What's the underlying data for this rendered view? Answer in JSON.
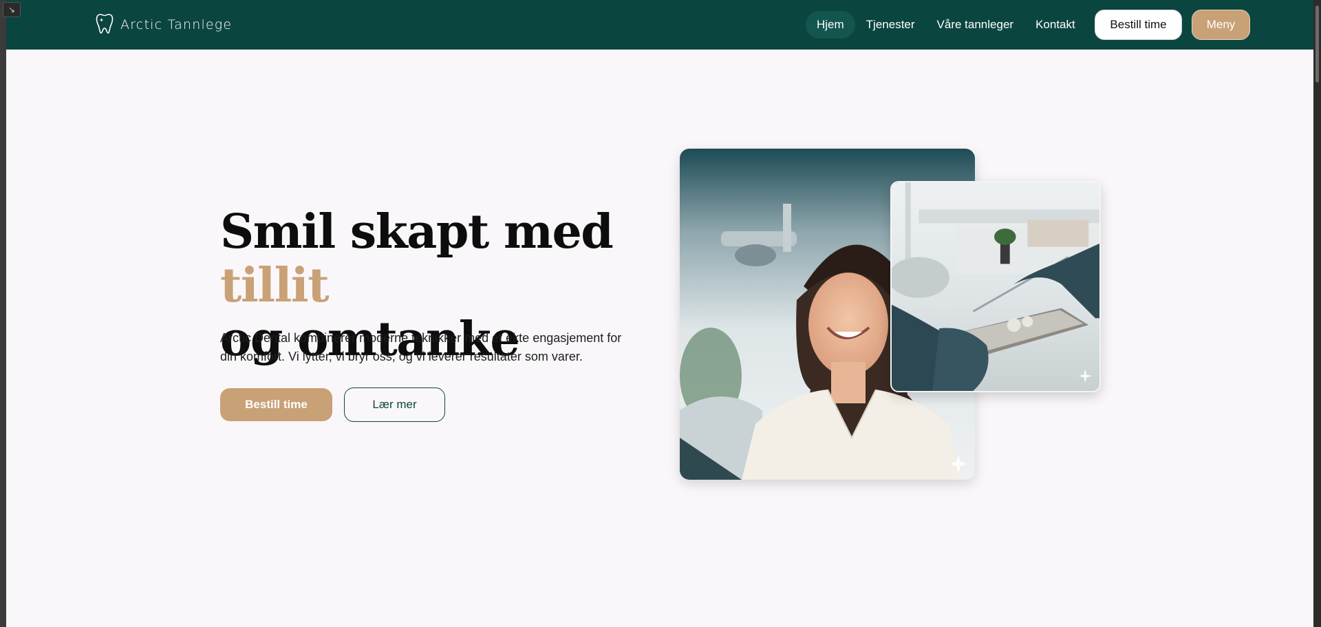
{
  "brand": {
    "name": "Arctic Tannlege",
    "logo_icon": "tooth-icon"
  },
  "nav": {
    "items": [
      {
        "label": "Hjem",
        "active": true
      },
      {
        "label": "Tjenester",
        "active": false
      },
      {
        "label": "Våre tannleger",
        "active": false
      },
      {
        "label": "Kontakt",
        "active": false
      }
    ],
    "book_label": "Bestill time",
    "menu_label": "Meny"
  },
  "hero": {
    "title_part1": "Smil skapt med ",
    "title_accent": "tillit",
    "title_part2": "og omtanke",
    "description": "Arctic Dental kombinerer moderne teknikker med et ekte engasjement for din komfort. Vi lytter, vi bryr oss, og vi leverer resultater som varer.",
    "primary_button": "Bestill time",
    "secondary_button": "Lær mer"
  },
  "images": {
    "main": "smiling-patient-photo",
    "secondary": "dental-instruments-photo"
  },
  "colors": {
    "nav_bg": "#0b4540",
    "accent": "#c9a177",
    "page_bg": "#f9f7f9"
  },
  "window": {
    "corner_icon": "resize-arrow-icon",
    "corner_glyph": "↘"
  }
}
